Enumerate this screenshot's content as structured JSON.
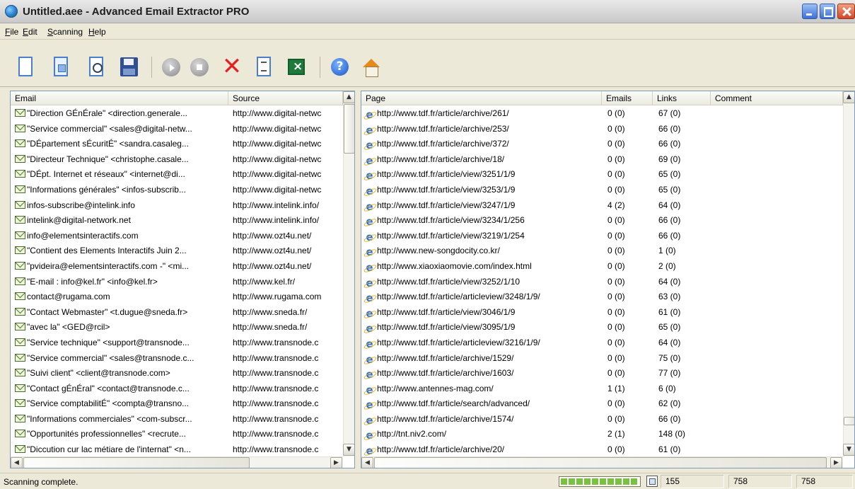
{
  "window": {
    "title": "Untitled.aee - Advanced Email Extractor PRO"
  },
  "menu": [
    "File",
    "Edit",
    "Scanning",
    "Help"
  ],
  "toolbar": {
    "icons": [
      "new-document-icon",
      "open-project-icon",
      "find-icon",
      "save-icon",
      "start-icon",
      "stop-icon",
      "delete-icon",
      "export-icon",
      "excel-icon",
      "help-icon",
      "home-icon"
    ]
  },
  "left_list": {
    "columns": [
      "Email",
      "Source"
    ],
    "rows": [
      {
        "email": "\"Direction GÉnÉrale\" <direction.generale...",
        "source": "http://www.digital-netwc"
      },
      {
        "email": "\"Service commercial\" <sales@digital-netw...",
        "source": "http://www.digital-netwc"
      },
      {
        "email": "\"DÉpartement sÉcuritÉ\" <sandra.casaleg...",
        "source": "http://www.digital-netwc"
      },
      {
        "email": "\"Directeur Technique\" <christophe.casale...",
        "source": "http://www.digital-netwc"
      },
      {
        "email": "\"DÉpt. Internet et réseaux\" <internet@di...",
        "source": "http://www.digital-netwc"
      },
      {
        "email": "\"Informations générales\" <infos-subscrib...",
        "source": "http://www.digital-netwc"
      },
      {
        "email": "infos-subscribe@intelink.info",
        "source": "http://www.intelink.info/"
      },
      {
        "email": "intelink@digital-network.net",
        "source": "http://www.intelink.info/"
      },
      {
        "email": "info@elementsinteractifs.com",
        "source": "http://www.ozt4u.net/"
      },
      {
        "email": "\"Contient des Elements Interactifs   Juin 2...",
        "source": "http://www.ozt4u.net/"
      },
      {
        "email": "\"pvideira@elementsinteractifs.com -\" <mi...",
        "source": "http://www.ozt4u.net/"
      },
      {
        "email": "\"E-mail : info@kel.fr\" <info@kel.fr>",
        "source": "http://www.kel.fr/"
      },
      {
        "email": "contact@rugama.com",
        "source": "http://www.rugama.com"
      },
      {
        "email": "\"Contact Webmaster\" <t.dugue@sneda.fr>",
        "source": "http://www.sneda.fr/"
      },
      {
        "email": "\"avec la\" <GED@rcil>",
        "source": "http://www.sneda.fr/"
      },
      {
        "email": "\"Service technique\" <support@transnode...",
        "source": "http://www.transnode.c"
      },
      {
        "email": "\"Service commercial\" <sales@transnode.c...",
        "source": "http://www.transnode.c"
      },
      {
        "email": "\"Suivi client\" <client@transnode.com>",
        "source": "http://www.transnode.c"
      },
      {
        "email": "\"Contact gÉnÉral\" <contact@transnode.c...",
        "source": "http://www.transnode.c"
      },
      {
        "email": "\"Service comptabilitÉ\" <compta@transno...",
        "source": "http://www.transnode.c"
      },
      {
        "email": "\"Informations commerciales\" <com-subscr...",
        "source": "http://www.transnode.c"
      },
      {
        "email": "\"Opportunités professionnelles\" <recrute...",
        "source": "http://www.transnode.c"
      },
      {
        "email": "\"Diccution cur lac métiare de l'internat\" <n...",
        "source": "http://www.transnode.c"
      }
    ]
  },
  "right_list": {
    "columns": [
      "Page",
      "Emails",
      "Links",
      "Comment"
    ],
    "rows": [
      {
        "page": "http://www.tdf.fr/article/archive/261/",
        "emails": "0 (0)",
        "links": "67 (0)"
      },
      {
        "page": "http://www.tdf.fr/article/archive/253/",
        "emails": "0 (0)",
        "links": "66 (0)"
      },
      {
        "page": "http://www.tdf.fr/article/archive/372/",
        "emails": "0 (0)",
        "links": "66 (0)"
      },
      {
        "page": "http://www.tdf.fr/article/archive/18/",
        "emails": "0 (0)",
        "links": "69 (0)"
      },
      {
        "page": "http://www.tdf.fr/article/view/3251/1/9",
        "emails": "0 (0)",
        "links": "65 (0)"
      },
      {
        "page": "http://www.tdf.fr/article/view/3253/1/9",
        "emails": "0 (0)",
        "links": "65 (0)"
      },
      {
        "page": "http://www.tdf.fr/article/view/3247/1/9",
        "emails": "4 (2)",
        "links": "64 (0)"
      },
      {
        "page": "http://www.tdf.fr/article/view/3234/1/256",
        "emails": "0 (0)",
        "links": "66 (0)"
      },
      {
        "page": "http://www.tdf.fr/article/view/3219/1/254",
        "emails": "0 (0)",
        "links": "66 (0)"
      },
      {
        "page": "http://www.new-songdocity.co.kr/",
        "emails": "0 (0)",
        "links": "1 (0)"
      },
      {
        "page": "http://www.xiaoxiaomovie.com/index.html",
        "emails": "0 (0)",
        "links": "2 (0)"
      },
      {
        "page": "http://www.tdf.fr/article/view/3252/1/10",
        "emails": "0 (0)",
        "links": "64 (0)"
      },
      {
        "page": "http://www.tdf.fr/article/articleview/3248/1/9/",
        "emails": "0 (0)",
        "links": "63 (0)"
      },
      {
        "page": "http://www.tdf.fr/article/view/3046/1/9",
        "emails": "0 (0)",
        "links": "61 (0)"
      },
      {
        "page": "http://www.tdf.fr/article/view/3095/1/9",
        "emails": "0 (0)",
        "links": "65 (0)"
      },
      {
        "page": "http://www.tdf.fr/article/articleview/3216/1/9/",
        "emails": "0 (0)",
        "links": "64 (0)"
      },
      {
        "page": "http://www.tdf.fr/article/archive/1529/",
        "emails": "0 (0)",
        "links": "75 (0)"
      },
      {
        "page": "http://www.tdf.fr/article/archive/1603/",
        "emails": "0 (0)",
        "links": "77 (0)"
      },
      {
        "page": "http://www.antennes-mag.com/",
        "emails": "1 (1)",
        "links": "6 (0)"
      },
      {
        "page": "http://www.tdf.fr/article/search/advanced/",
        "emails": "0 (0)",
        "links": "62 (0)"
      },
      {
        "page": "http://www.tdf.fr/article/archive/1574/",
        "emails": "0 (0)",
        "links": "66 (0)"
      },
      {
        "page": "http://tnt.niv2.com/",
        "emails": "2 (1)",
        "links": "148 (0)"
      },
      {
        "page": "http://www.tdf.fr/article/archive/20/",
        "emails": "0 (0)",
        "links": "61 (0)"
      }
    ]
  },
  "status": {
    "text": "Scanning complete.",
    "progress_fraction": 1.0,
    "count1": "155",
    "count2": "758",
    "count3": "758"
  }
}
